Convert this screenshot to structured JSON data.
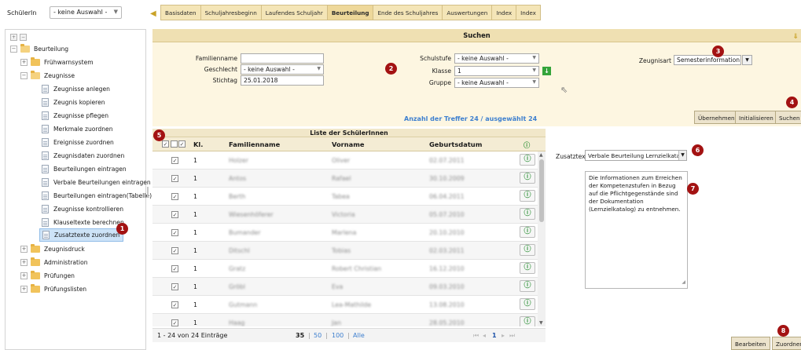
{
  "topbar": {
    "schueler_label": "SchülerIn",
    "schueler_select": "- keine Auswahl -",
    "tabs": [
      "Basisdaten",
      "Schuljahresbeginn",
      "Laufendes Schuljahr",
      "Beurteilung",
      "Ende des Schuljahres",
      "Auswertungen",
      "Index",
      "Index"
    ],
    "active_tab": "Beurteilung"
  },
  "tree": {
    "root": "Beurteilung",
    "fruehwarn": "Frühwarnsystem",
    "zeugnisse": "Zeugnisse",
    "leaves": [
      "Zeugnisse anlegen",
      "Zeugnis kopieren",
      "Zeugnisse pflegen",
      "Merkmale zuordnen",
      "Ereignisse zuordnen",
      "Zeugnisdaten zuordnen",
      "Beurteilungen eintragen",
      "Verbale Beurteilungen eintragen",
      "Beurteilungen eintragen(Tabelle)",
      "Zeugnisse kontrollieren",
      "Klauseltexte berechnen",
      "Zusatztexte zuordnen"
    ],
    "others": [
      "Zeugnisdruck",
      "Administration",
      "Prüfungen",
      "Prüfungslisten"
    ]
  },
  "search": {
    "title": "Suchen",
    "familienname_label": "Familienname",
    "familienname_value": "",
    "geschlecht_label": "Geschlecht",
    "geschlecht_value": "- keine Auswahl -",
    "stichtag_label": "Stichtag",
    "stichtag_value": "25.01.2018",
    "schulstufe_label": "Schulstufe",
    "schulstufe_value": "- keine Auswahl -",
    "klasse_label": "Klasse",
    "klasse_value": "1",
    "gruppe_label": "Gruppe",
    "gruppe_value": "- keine Auswahl -",
    "zeugnisart_label": "Zeugnisart",
    "zeugnisart_value": "Semesterinformation",
    "hits_text": "Anzahl der Treffer  24 / ausgewählt  24",
    "btn_uebernehmen": "Übernehmen",
    "btn_initialisieren": "Initialisieren",
    "btn_suchen": "Suchen"
  },
  "list": {
    "title": "Liste der SchülerInnen",
    "columns": [
      "Kl.",
      "Familienname",
      "Vorname",
      "Geburtsdatum"
    ],
    "rows": [
      {
        "kl": "1",
        "familienname": "Holzer",
        "vorname": "Oliver",
        "geburtsdatum": "02.07.2011"
      },
      {
        "kl": "1",
        "familienname": "Antos",
        "vorname": "Rafael",
        "geburtsdatum": "30.10.2009"
      },
      {
        "kl": "1",
        "familienname": "Berth",
        "vorname": "Tabea",
        "geburtsdatum": "06.04.2011"
      },
      {
        "kl": "1",
        "familienname": "Wiesenhöferer",
        "vorname": "Victoria",
        "geburtsdatum": "05.07.2010"
      },
      {
        "kl": "1",
        "familienname": "Bumander",
        "vorname": "Marlena",
        "geburtsdatum": "20.10.2010"
      },
      {
        "kl": "1",
        "familienname": "Ditschl",
        "vorname": "Tobias",
        "geburtsdatum": "02.03.2011"
      },
      {
        "kl": "1",
        "familienname": "Gratz",
        "vorname": "Robert Christian",
        "geburtsdatum": "16.12.2010"
      },
      {
        "kl": "1",
        "familienname": "Gröbl",
        "vorname": "Eva",
        "geburtsdatum": "09.03.2010"
      },
      {
        "kl": "1",
        "familienname": "Gutmann",
        "vorname": "Lea-Mathilde",
        "geburtsdatum": "13.08.2010"
      },
      {
        "kl": "1",
        "familienname": "Haag",
        "vorname": "Jan",
        "geburtsdatum": "28.05.2010"
      }
    ],
    "pager_count": "1 - 24 von 24 Einträge",
    "pager_35": "35",
    "pager_50": "50",
    "pager_100": "100",
    "pager_alle": "Alle",
    "pager_page": "1"
  },
  "zusatz": {
    "label": "Zusatztext",
    "select_value": "Verbale Beurteilung Lernzielkatalog",
    "text": "Die Informationen zum Erreichen der Kompetenzstufen in Bezug auf die Pflichtgegenstände sind der Dokumentation (Lernzielkatalog) zu entnehmen.",
    "btn_bearbeiten": "Bearbeiten",
    "btn_zuordnen": "Zuordnen"
  },
  "markers": [
    "1",
    "2",
    "3",
    "4",
    "5",
    "6",
    "7",
    "8"
  ]
}
